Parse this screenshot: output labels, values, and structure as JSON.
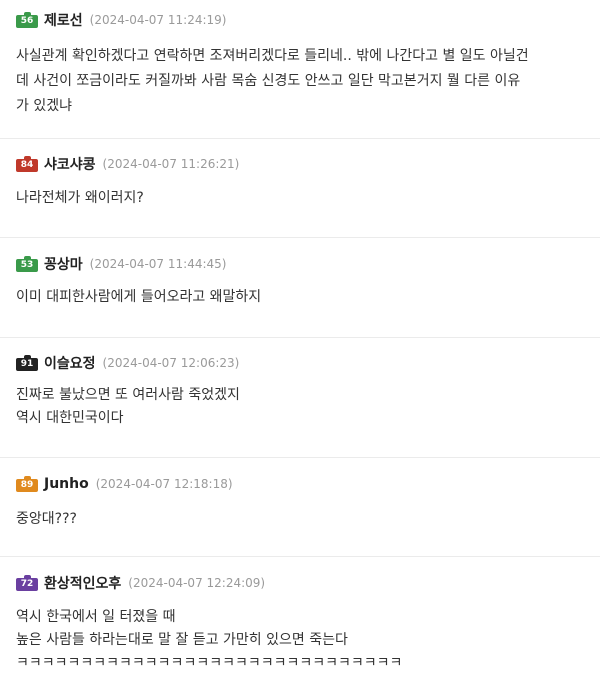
{
  "comments": [
    {
      "level": "56",
      "badge_color": "#3a9a4a",
      "username": "제로선",
      "timestamp": "(2024-04-07 11:24:19)",
      "text": "사실관계 확인하겠다고 연락하면 조져버리겠다로 들리네.. 밖에 나간다고 별 일도 아닐건\n데 사건이 쪼금이라도 커질까봐 사람 목숨 신경도 안쓰고 일단 막고본거지 뭘 다른 이유\n가 있겠냐"
    },
    {
      "level": "84",
      "badge_color": "#c0392b",
      "username": "샤코샤콩",
      "timestamp": "(2024-04-07 11:26:21)",
      "text": "나라전체가 왜이러지?"
    },
    {
      "level": "53",
      "badge_color": "#3a9a4a",
      "username": "꽁상마",
      "timestamp": "(2024-04-07 11:44:45)",
      "text": "이미 대피한사람에게 들어오라고 왜말하지"
    },
    {
      "level": "91",
      "badge_color": "#222222",
      "username": "이슬요정",
      "timestamp": "(2024-04-07 12:06:23)",
      "text": "진짜로 불났으면 또 여러사람 죽었겠지\n역시 대한민국이다"
    },
    {
      "level": "89",
      "badge_color": "#e08a1e",
      "username": "Junho",
      "timestamp": "(2024-04-07 12:18:18)",
      "text": "중앙대???"
    },
    {
      "level": "72",
      "badge_color": "#6a3fa0",
      "username": "환상적인오후",
      "timestamp": "(2024-04-07 12:24:09)",
      "text": "역시 한국에서 일 터졌을 때\n높은 사람들 하라는대로 말 잘 듣고 가만히 있으면 죽는다\nㅋㅋㅋㅋㅋㅋㅋㅋㅋㅋㅋㅋㅋㅋㅋㅋㅋㅋㅋㅋㅋㅋㅋㅋㅋㅋㅋㅋㅋㅋ"
    }
  ]
}
